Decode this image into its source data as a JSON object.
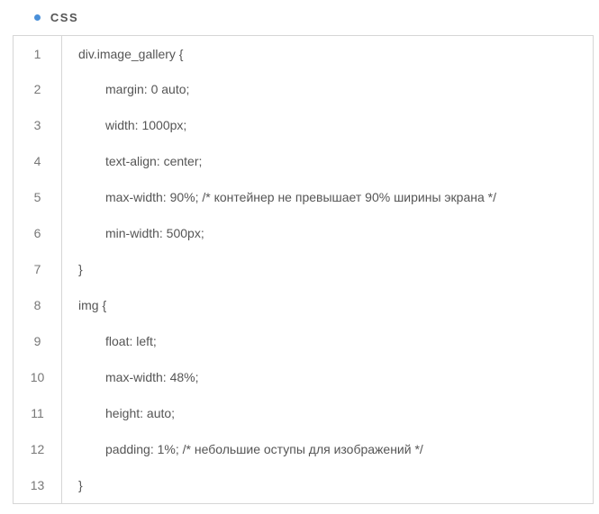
{
  "header": {
    "label": "CSS"
  },
  "code": {
    "lines": [
      {
        "n": "1",
        "text": "div.image_gallery {",
        "indent": 0
      },
      {
        "n": "2",
        "text": "margin: 0 auto;",
        "indent": 1
      },
      {
        "n": "3",
        "text": "width: 1000px;",
        "indent": 1
      },
      {
        "n": "4",
        "text": "text-align: center;",
        "indent": 1
      },
      {
        "n": "5",
        "text": "max-width: 90%; /* контейнер не превышает 90% ширины экрана */",
        "indent": 1
      },
      {
        "n": "6",
        "text": "min-width: 500px;",
        "indent": 1
      },
      {
        "n": "7",
        "text": "}",
        "indent": 0
      },
      {
        "n": "8",
        "text": "img {",
        "indent": 0
      },
      {
        "n": "9",
        "text": "float: left;",
        "indent": 1
      },
      {
        "n": "10",
        "text": "max-width: 48%;",
        "indent": 1
      },
      {
        "n": "11",
        "text": "height: auto;",
        "indent": 1
      },
      {
        "n": "12",
        "text": "padding: 1%; /* небольшие оступы для изображений */",
        "indent": 1
      },
      {
        "n": "13",
        "text": "}",
        "indent": 0
      }
    ]
  }
}
